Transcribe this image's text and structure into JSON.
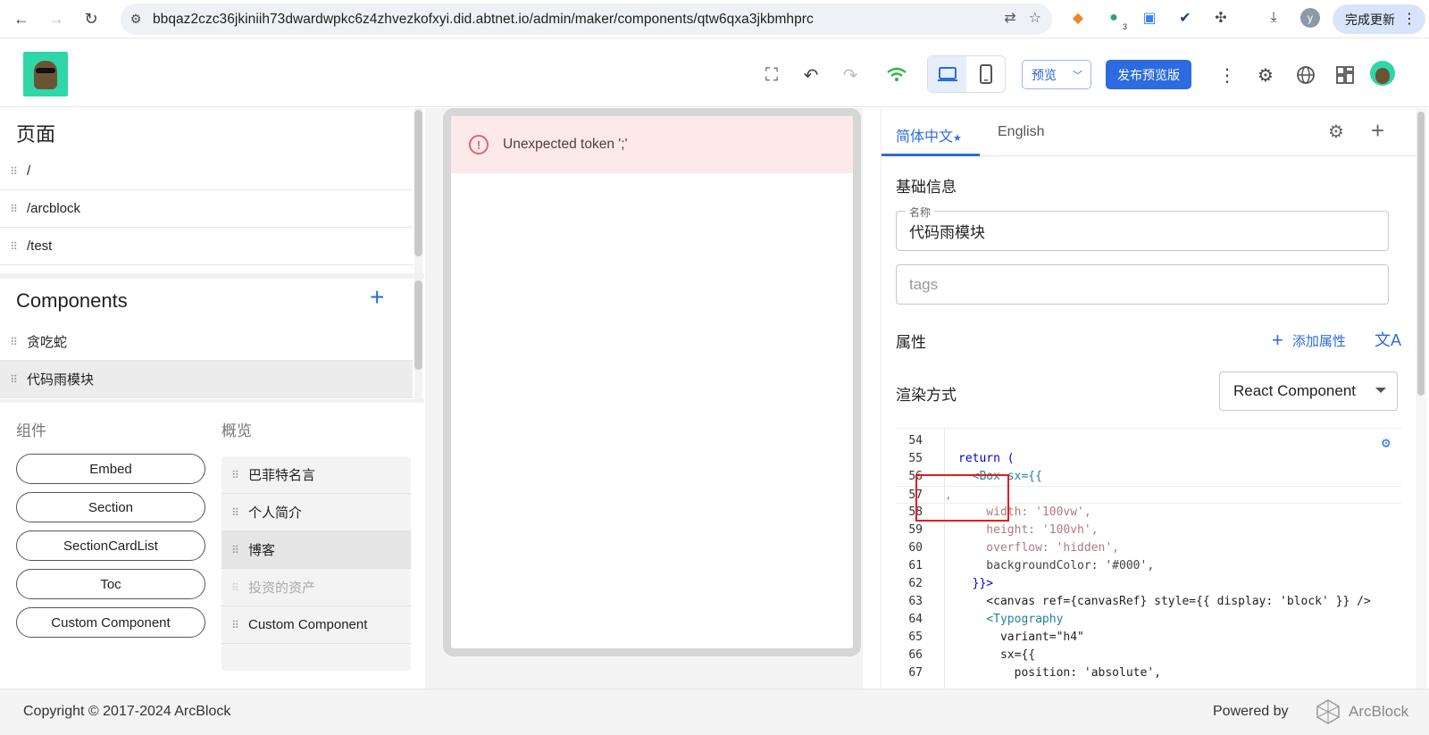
{
  "browser": {
    "url": "bbqaz2czc36jkiniih73dwardwpkc6z4zhvezkofxyi.did.abtnet.io/admin/maker/components/qtw6qxa3jkbmhprc",
    "extension_badge": "3",
    "profile_initial": "y",
    "update_label": "完成更新"
  },
  "toolbar": {
    "preview_label": "预览",
    "publish_label": "发布预览版"
  },
  "pages": {
    "title": "页面",
    "items": [
      {
        "label": "/"
      },
      {
        "label": "/arcblock"
      },
      {
        "label": "/test"
      }
    ]
  },
  "components": {
    "title": "Components",
    "items": [
      {
        "label": "贪吃蛇"
      },
      {
        "label": "代码雨模块"
      }
    ]
  },
  "library": {
    "title": "组件",
    "items": [
      "Embed",
      "Section",
      "SectionCardList",
      "Toc",
      "Custom Component"
    ]
  },
  "overview": {
    "title": "概览",
    "items": [
      {
        "label": "巴菲特名言"
      },
      {
        "label": "个人简介"
      },
      {
        "label": "博客"
      },
      {
        "label": "投资的资产"
      },
      {
        "label": "Custom Component"
      }
    ]
  },
  "preview": {
    "error": "Unexpected token ';'"
  },
  "panel": {
    "tabs": [
      "简体中文",
      "English"
    ],
    "basic_info": "基础信息",
    "name_legend": "名称",
    "name_value": "代码雨模块",
    "tags_placeholder": "tags",
    "props_label": "属性",
    "add_prop_label": "添加属性",
    "render_label": "渲染方式",
    "render_value": "React Component"
  },
  "code": {
    "lines": [
      {
        "n": "54",
        "text": ""
      },
      {
        "n": "55",
        "text": "return ("
      },
      {
        "n": "56",
        "text": "  <Box sx={{"
      },
      {
        "n": "57",
        "text": ","
      },
      {
        "n": "58",
        "text": "    width: '100vw',"
      },
      {
        "n": "59",
        "text": "    height: '100vh',"
      },
      {
        "n": "60",
        "text": "    overflow: 'hidden',"
      },
      {
        "n": "61",
        "text": "    backgroundColor: '#000',"
      },
      {
        "n": "62",
        "text": "  }}>"
      },
      {
        "n": "63",
        "text": "    <canvas ref={canvasRef} style={{ display: 'block' }} />"
      },
      {
        "n": "64",
        "text": "    <Typography"
      },
      {
        "n": "65",
        "text": "      variant=\"h4\""
      },
      {
        "n": "66",
        "text": "      sx={{"
      },
      {
        "n": "67",
        "text": "        position: 'absolute',"
      }
    ]
  },
  "footer": {
    "copyright": "Copyright © 2017-2024  ArcBlock",
    "powered_by": "Powered by",
    "brand": "ArcBlock"
  },
  "colors": {
    "accent": "#2c6be0",
    "error_bg": "#fde9ea",
    "error_icon": "#e06669",
    "highlight_box": "#e01e1e"
  }
}
